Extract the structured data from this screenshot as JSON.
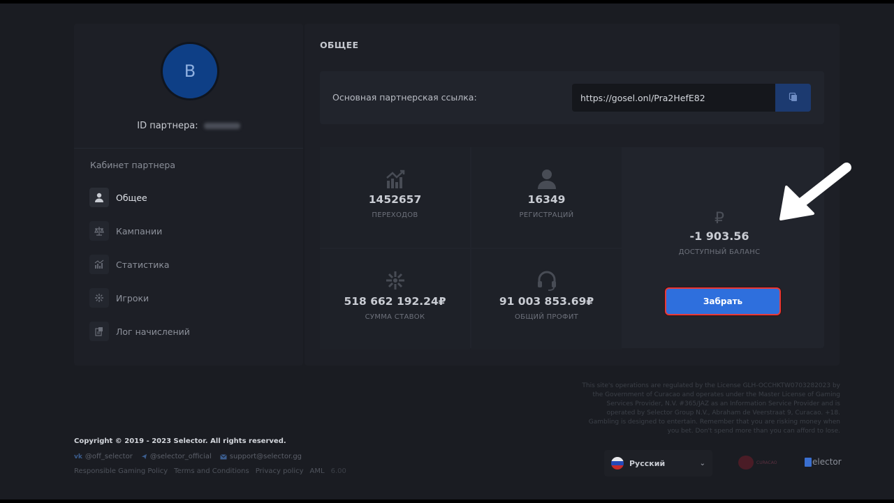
{
  "sidebar": {
    "avatar_letter": "B",
    "partner_id_label": "ID партнера:",
    "cabinet_title": "Кабинет партнера",
    "items": [
      {
        "label": "Общее",
        "icon": "user-icon",
        "active": true
      },
      {
        "label": "Кампании",
        "icon": "scales-icon",
        "active": false
      },
      {
        "label": "Статистика",
        "icon": "chart-icon",
        "active": false
      },
      {
        "label": "Игроки",
        "icon": "spinner-icon",
        "active": false
      },
      {
        "label": "Лог начислений",
        "icon": "log-icon",
        "active": false
      }
    ]
  },
  "main": {
    "title": "ОБЩЕЕ",
    "link_label": "Основная партнерская ссылка:",
    "link_value": "https://gosel.onl/Pra2HefE82",
    "stats": [
      {
        "value": "1452657",
        "label": "ПЕРЕХОДОВ",
        "icon": "growth-chart-icon"
      },
      {
        "value": "16349",
        "label": "РЕГИСТРАЦИЙ",
        "icon": "user-icon"
      },
      {
        "value": "518 662 192.24₽",
        "label": "СУММА СТАВОК",
        "icon": "spinner-icon"
      },
      {
        "value": "91 003 853.69₽",
        "label": "ОБЩИЙ ПРОФИТ",
        "icon": "headset-icon"
      }
    ],
    "balance": {
      "currency_symbol": "₽",
      "value": "-1 903.56",
      "label": "ДОСТУПНЫЙ БАЛАНС",
      "button_label": "Забрать"
    }
  },
  "footer": {
    "copyright": "Copyright © 2019 - 2023 Selector. All rights reserved.",
    "socials": [
      {
        "label": "@off_selector",
        "icon": "vk-icon"
      },
      {
        "label": "@selector_official",
        "icon": "telegram-icon"
      },
      {
        "label": "support@selector.gg",
        "icon": "mail-icon"
      }
    ],
    "links": [
      "Responsible Gaming Policy",
      "Terms and Conditions",
      "Privacy policy",
      "AML",
      "6.00"
    ],
    "license_text": "This site's operations are regulated by the License GLH-OCCHKTW0703282023 by the Government of Curacao and operates under the Master License of Gaming Services Provider, N.V. #365/JAZ as an Information Service Provider and is operated by Selector Group N.V., Abraham de Veerstraat 9, Curacao. +18. Gambling is designed to entertain. Remember that you are risking money when you bet. Don't spend more than you can afford to lose.",
    "language": "Русский",
    "curacao_text": "CURACAO",
    "selector_logo_text": "elector"
  }
}
